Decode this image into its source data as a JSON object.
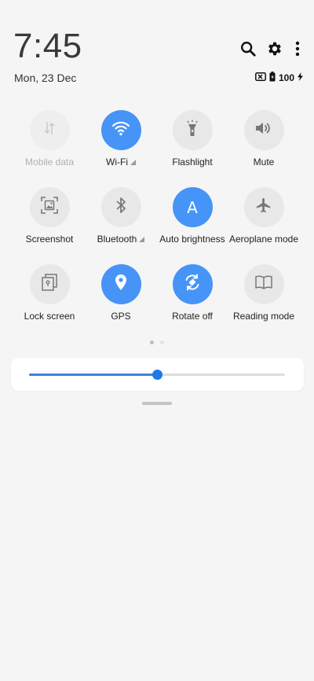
{
  "header": {
    "time": "7:45",
    "date": "Mon, 23 Dec",
    "battery_level": "100"
  },
  "tiles": [
    [
      {
        "label": "Mobile data",
        "state": "disabled",
        "icon": "mobile-data-icon"
      },
      {
        "label": "Wi-Fi",
        "state": "on",
        "icon": "wifi-icon",
        "expand": true
      },
      {
        "label": "Flashlight",
        "state": "off",
        "icon": "flashlight-icon"
      },
      {
        "label": "Mute",
        "state": "off",
        "icon": "volume-icon"
      }
    ],
    [
      {
        "label": "Screenshot",
        "state": "off",
        "icon": "screenshot-icon"
      },
      {
        "label": "Bluetooth",
        "state": "off",
        "icon": "bluetooth-icon",
        "expand": true
      },
      {
        "label": "Auto brightness",
        "state": "on",
        "icon": "auto-brightness-icon",
        "glyph": "A"
      },
      {
        "label": "Aeroplane mode",
        "state": "off",
        "icon": "aeroplane-icon"
      }
    ],
    [
      {
        "label": "Lock screen",
        "state": "off",
        "icon": "lock-screen-icon"
      },
      {
        "label": "GPS",
        "state": "on",
        "icon": "location-pin-icon"
      },
      {
        "label": "Rotate off",
        "state": "on",
        "icon": "rotate-icon"
      },
      {
        "label": "Reading mode",
        "state": "off",
        "icon": "book-icon"
      }
    ]
  ],
  "pager": {
    "pages": 2,
    "current": 1
  },
  "brightness": {
    "level": 0.5
  },
  "colors": {
    "accent": "#4694f7",
    "tile_off": "#e8e8e8",
    "slider": "#1f7ae8"
  }
}
